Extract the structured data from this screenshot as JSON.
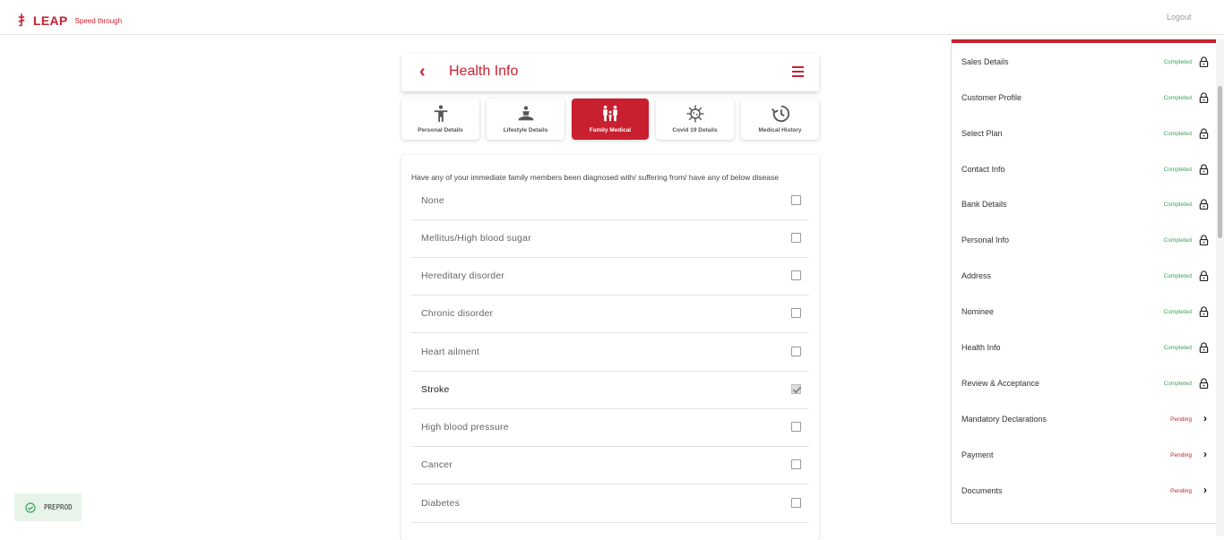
{
  "app": {
    "brand": "LEAP",
    "tagline": "Speed through",
    "logout_label": "Logout"
  },
  "header": {
    "title": "Health Info"
  },
  "tabs": [
    {
      "label": "Personal Details",
      "icon": "person-icon",
      "active": false
    },
    {
      "label": "Lifestyle Details",
      "icon": "meditation-icon",
      "active": false
    },
    {
      "label": "Family Medical",
      "icon": "family-icon",
      "active": true
    },
    {
      "label": "Covid 19 Details",
      "icon": "virus-icon",
      "active": false
    },
    {
      "label": "Medical History",
      "icon": "history-icon",
      "active": false
    }
  ],
  "form": {
    "question": "Have any of your immediate family members been diagnosed with/ suffering from/ have any of below disease",
    "options": [
      {
        "label": "None",
        "checked": false
      },
      {
        "label": "Mellitus/High blood sugar",
        "checked": false
      },
      {
        "label": "Hereditary disorder",
        "checked": false
      },
      {
        "label": "Chronic disorder",
        "checked": false
      },
      {
        "label": "Heart ailment",
        "checked": false
      },
      {
        "label": "Stroke",
        "checked": true
      },
      {
        "label": "High blood pressure",
        "checked": false
      },
      {
        "label": "Cancer",
        "checked": false
      },
      {
        "label": "Diabetes",
        "checked": false
      }
    ]
  },
  "sidebar": {
    "items": [
      {
        "label": "Sales Details",
        "status": "Completed",
        "icon": "lock-icon"
      },
      {
        "label": "Customer Profile",
        "status": "Completed",
        "icon": "lock-icon"
      },
      {
        "label": "Select Plan",
        "status": "Completed",
        "icon": "lock-icon"
      },
      {
        "label": "Contact Info",
        "status": "Completed",
        "icon": "lock-icon"
      },
      {
        "label": "Bank Details",
        "status": "Completed",
        "icon": "lock-icon"
      },
      {
        "label": "Personal Info",
        "status": "Completed",
        "icon": "lock-icon"
      },
      {
        "label": "Address",
        "status": "Completed",
        "icon": "lock-icon"
      },
      {
        "label": "Nominee",
        "status": "Completed",
        "icon": "lock-icon"
      },
      {
        "label": "Health Info",
        "status": "Completed",
        "icon": "lock-icon"
      },
      {
        "label": "Review & Acceptance",
        "status": "Completed",
        "icon": "lock-icon"
      },
      {
        "label": "Mandatory Declarations",
        "status": "Pending",
        "icon": "chevron-right-icon"
      },
      {
        "label": "Payment",
        "status": "Pending",
        "icon": "chevron-right-icon"
      },
      {
        "label": "Documents",
        "status": "Pending",
        "icon": "chevron-right-icon"
      }
    ]
  },
  "env_badge": {
    "label": "PREPROD"
  },
  "colors": {
    "brand": "#c8202f",
    "completed": "#3aa35a",
    "pending": "#c8202f"
  }
}
